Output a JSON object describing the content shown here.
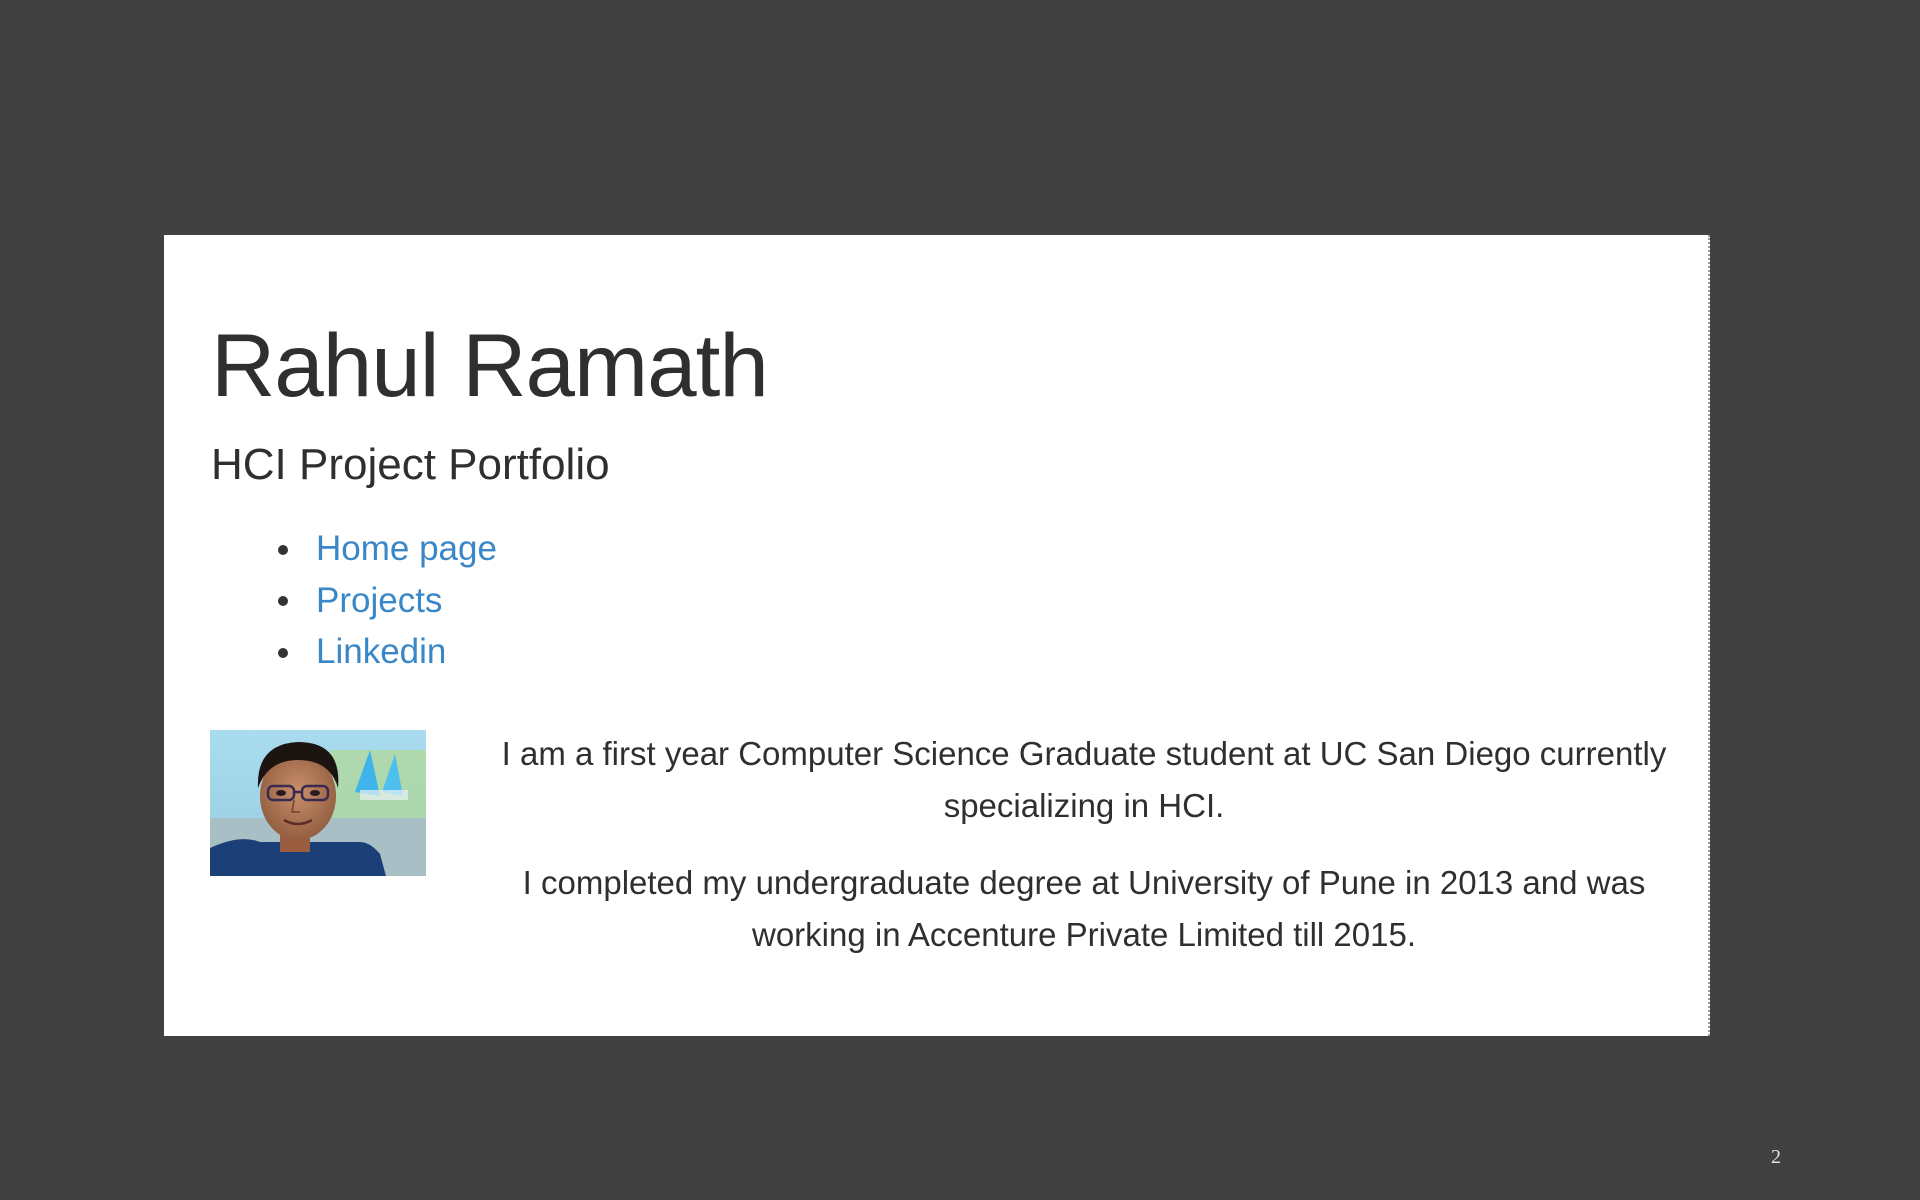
{
  "profile": {
    "name": "Rahul Ramath",
    "subtitle": "HCI Project Portfolio"
  },
  "nav": {
    "items": [
      {
        "label": "Home page"
      },
      {
        "label": "Projects"
      },
      {
        "label": "Linkedin"
      }
    ]
  },
  "bio": {
    "paragraph_1": "I am a first year Computer Science Graduate student at UC San Diego currently specializing in HCI.",
    "paragraph_2": "I completed my undergraduate degree at University of Pune in 2013 and was working in Accenture Private Limited till 2015."
  },
  "slide": {
    "page_number": "2"
  },
  "colors": {
    "background": "#414141",
    "card": "#ffffff",
    "link": "#3a87c8",
    "text": "#2f2f2f"
  }
}
